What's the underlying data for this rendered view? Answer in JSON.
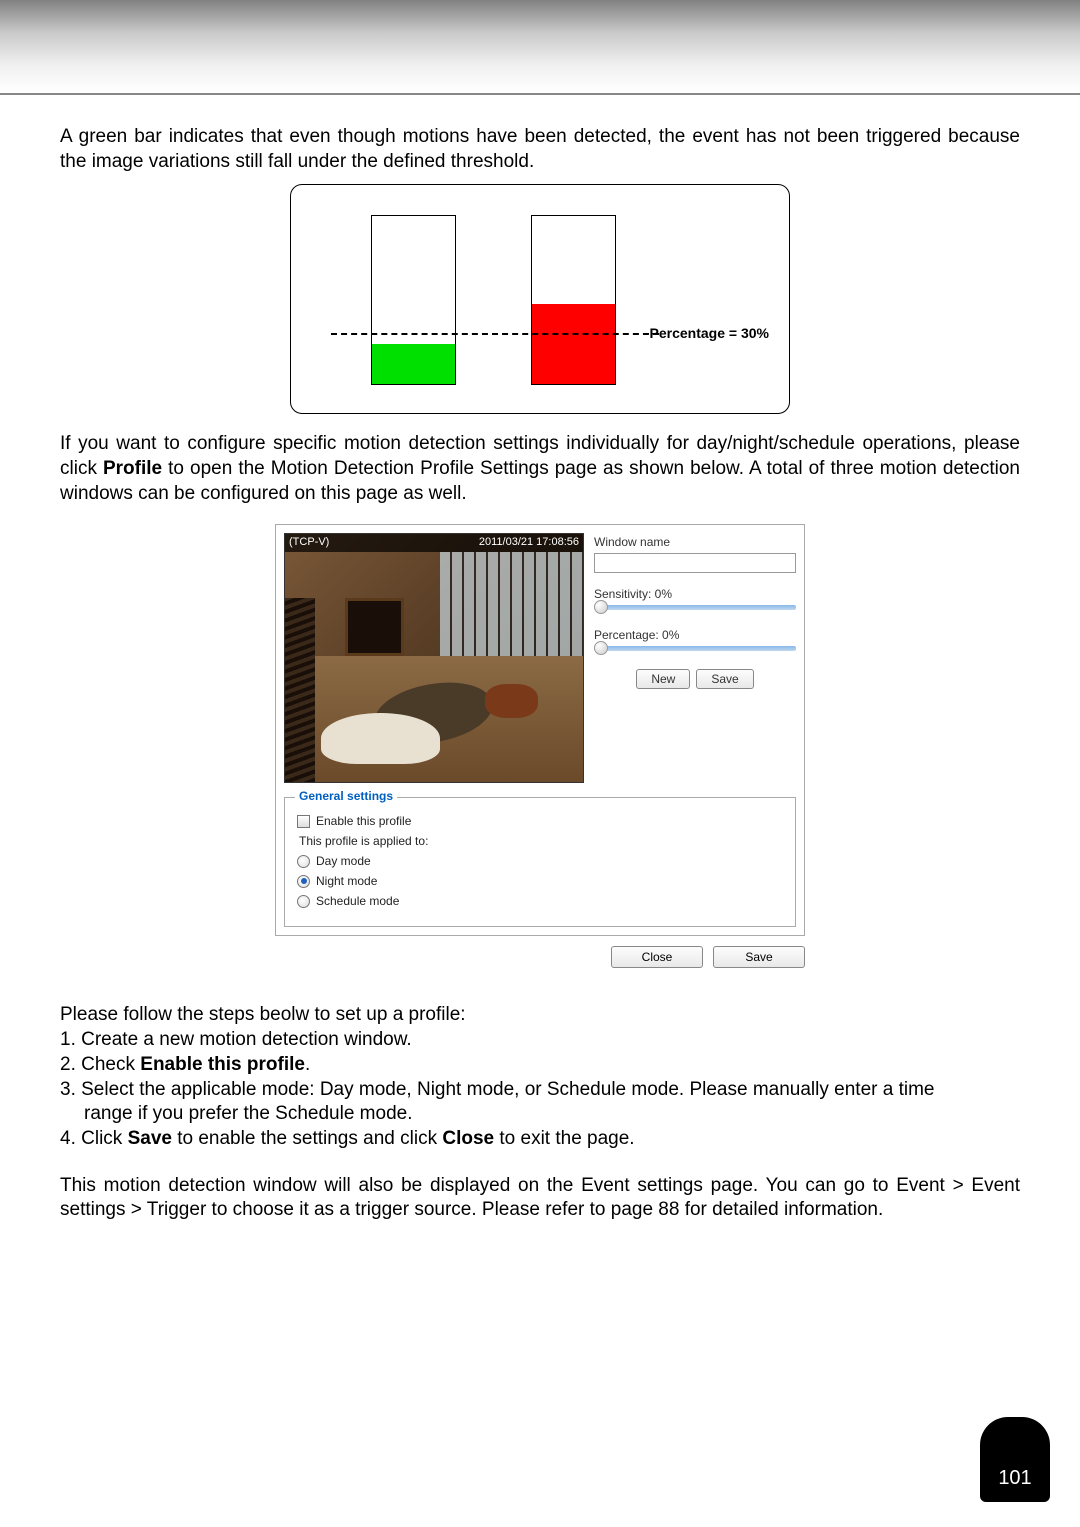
{
  "para1": "A green bar indicates that even though motions have been detected, the event has not been triggered because the image variations still fall under the defined threshold.",
  "percentage_label": "Percentage = 30%",
  "para2_a": "If you want to configure specific motion detection settings individually for day/night/schedule operations, please click ",
  "para2_b_bold": "Profile",
  "para2_c": " to open the Motion Detection Profile Settings page as shown below. A total of three motion detection windows can be configured on this page as well.",
  "video": {
    "title": "(TCP-V)",
    "timestamp": "2011/03/21 17:08:56"
  },
  "controls": {
    "window_name_label": "Window name",
    "sensitivity_label": "Sensitivity: 0%",
    "percentage_label": "Percentage: 0%",
    "new_btn": "New",
    "save_btn": "Save"
  },
  "general": {
    "legend": "General settings",
    "enable_label": "Enable this profile",
    "applied_label": "This profile is applied to:",
    "day_label": "Day mode",
    "night_label": "Night mode",
    "schedule_label": "Schedule mode"
  },
  "bottom": {
    "close": "Close",
    "save": "Save"
  },
  "steps": {
    "intro": "Please follow the steps beolw to set up a profile:",
    "s1": "1. Create a new motion detection window.",
    "s2a": "2. Check ",
    "s2b_bold": "Enable this profile",
    "s2c": ".",
    "s3a": "3. Select the applicable mode: Day mode, Night mode, or Schedule mode. Please manually enter a time",
    "s3b": "range if you prefer the Schedule mode.",
    "s4a": "4. Click ",
    "s4b_bold": "Save",
    "s4c": " to enable the settings and click ",
    "s4d_bold": "Close",
    "s4e": " to exit the page."
  },
  "para3": "This motion detection window will also be displayed on the Event settings page. You can go to Event > Event settings > Trigger to choose it as a trigger source. Please refer to page 88 for detailed information.",
  "page_number": "101"
}
